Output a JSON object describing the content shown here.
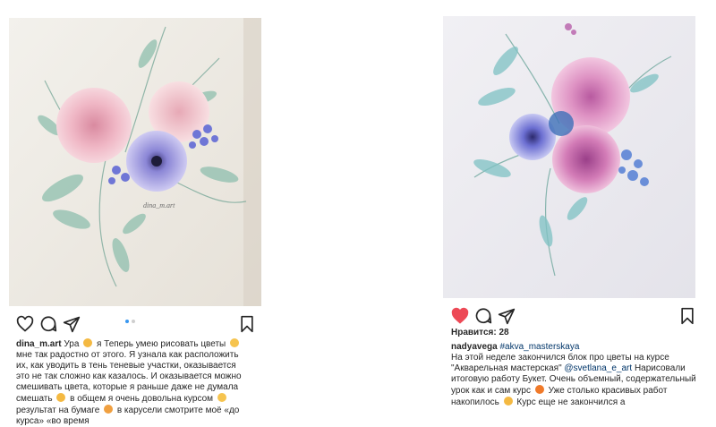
{
  "post_left": {
    "username": "dina_m.art",
    "caption_lines": [
      "Ура",
      "я Теперь умею рисовать цветы",
      "мне так радостно от этого. Я узнала как расположить их, как уводить в тень теневые участки, оказывается это не так сложно как казалось. И оказывается можно смешивать цвета, которые я раньше даже не думала смешать",
      "в общем я очень довольна курсом",
      "результат на бумаге",
      "в карусели смотрите моё «до курса» «во время"
    ],
    "carousel": {
      "count": 2,
      "active": 1
    },
    "photo_signature": "dina_m.art"
  },
  "post_right": {
    "likes": "Нравится: 28",
    "username": "nadyavega",
    "hashtag": "#akva_masterskaya",
    "caption_a": "На этой неделе закончился блок про цветы на курсе \"Акварельная мастерская\"",
    "mention": "@svetlana_e_art",
    "caption_b": "Нарисовали итоговую работу Букет. Очень объемный, содержательный урок как и сам курс",
    "caption_c": "Уже столько красивых работ накопилось",
    "caption_d": "Курс еще не закончился а"
  },
  "icons": {
    "heart": "heart-icon",
    "comment": "comment-icon",
    "share": "share-icon",
    "bookmark": "bookmark-icon"
  },
  "colors": {
    "liked_heart": "#ed4956",
    "hashtag": "#003569",
    "carousel_active": "#3897f0"
  }
}
